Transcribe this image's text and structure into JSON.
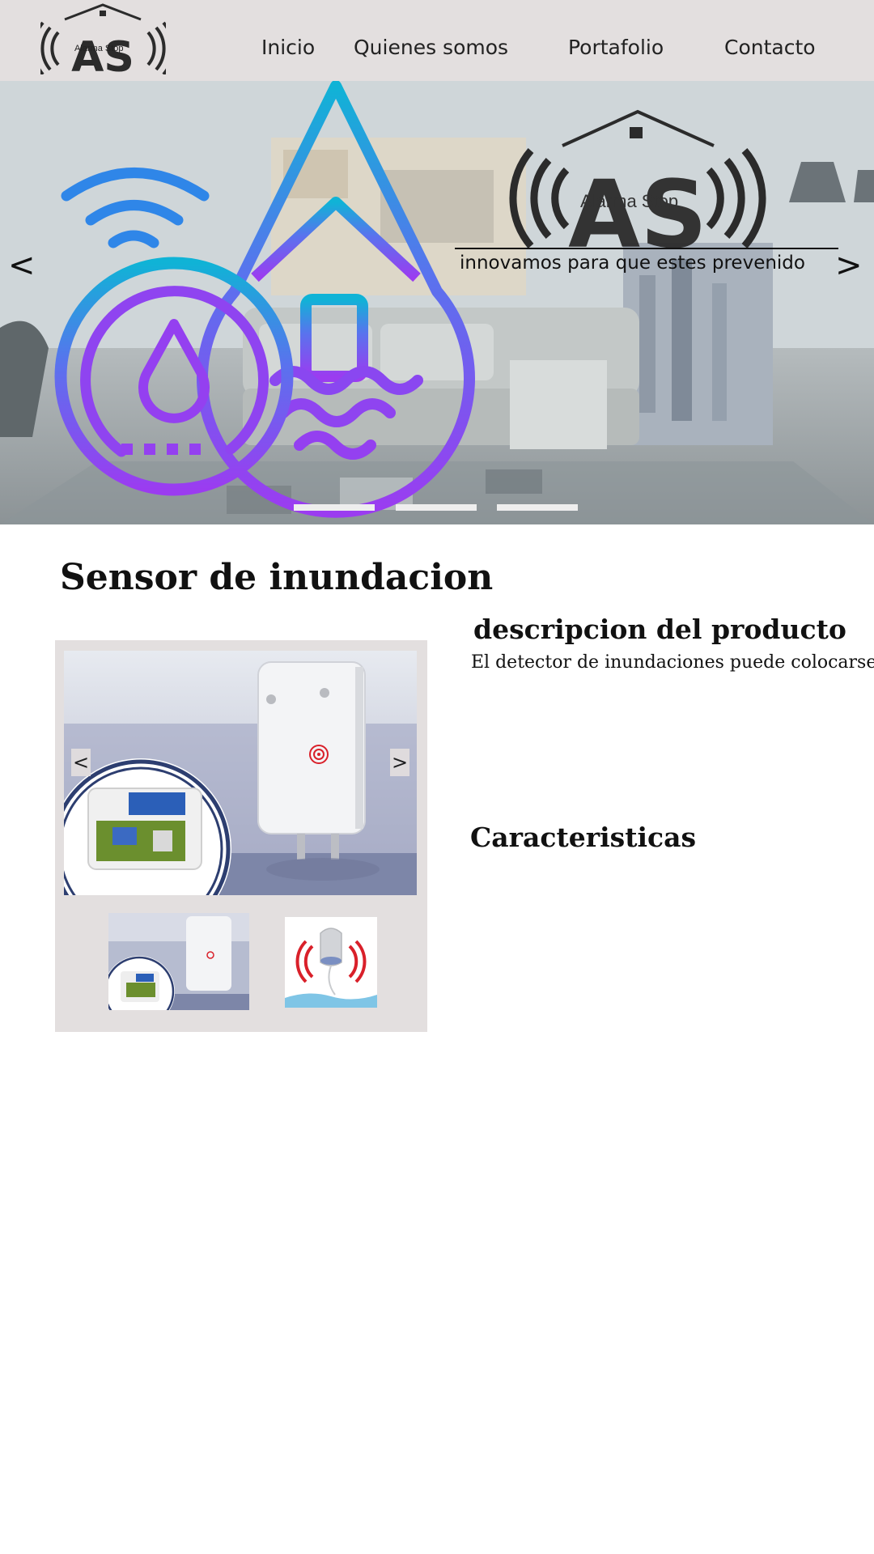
{
  "header": {
    "logo_text": "Alarma Stop",
    "nav": [
      {
        "label": "Inicio"
      },
      {
        "label": "Quienes somos"
      },
      {
        "label": "Portafolio"
      },
      {
        "label": "Contacto"
      }
    ]
  },
  "hero": {
    "brand": "Alarma Stop",
    "tagline": "innovamos para que estes prevenido",
    "prev_arrow": "<",
    "next_arrow": ">",
    "slides": 3
  },
  "product": {
    "title": "Sensor de inundacion",
    "description_title": "descripcion del producto",
    "description_text": "El detector de inundaciones puede colocarse",
    "features_title": "Caracteristicas",
    "gallery": {
      "prev_arrow": "<",
      "next_arrow": ">",
      "thumbnail_count": 2
    }
  },
  "colors": {
    "header_bg": "#e3dfdf",
    "icon_gradient_top": "#10b3d6",
    "icon_gradient_bottom": "#9b3cf0",
    "wifi_blue": "#2f86e8",
    "alert_red": "#d9202a"
  },
  "icons": [
    "house-logo-icon",
    "wifi-icon",
    "water-drop-icon",
    "flood-house-icon",
    "alarm-waves-icon"
  ]
}
